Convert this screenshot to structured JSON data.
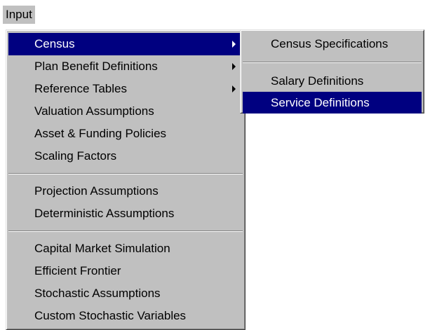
{
  "menubar": {
    "input_label": "Input"
  },
  "main_menu": {
    "items": [
      {
        "label": "Census",
        "has_submenu": true,
        "highlighted": true
      },
      {
        "label": "Plan Benefit Definitions",
        "has_submenu": true
      },
      {
        "label": "Reference Tables",
        "has_submenu": true
      },
      {
        "label": "Valuation Assumptions"
      },
      {
        "label": "Asset & Funding Policies"
      },
      {
        "label": "Scaling Factors"
      },
      {
        "label": "Projection Assumptions"
      },
      {
        "label": "Deterministic Assumptions"
      },
      {
        "label": "Capital Market Simulation"
      },
      {
        "label": "Efficient Frontier"
      },
      {
        "label": "Stochastic Assumptions"
      },
      {
        "label": "Custom Stochastic Variables"
      }
    ]
  },
  "census_submenu": {
    "items": [
      {
        "label": "Census Specifications"
      },
      {
        "label": "Salary Definitions"
      },
      {
        "label": "Service Definitions",
        "highlighted": true
      }
    ]
  },
  "colors": {
    "menu_background": "#c0c0c0",
    "highlight_background": "#000080",
    "highlight_text": "#ffffff"
  }
}
